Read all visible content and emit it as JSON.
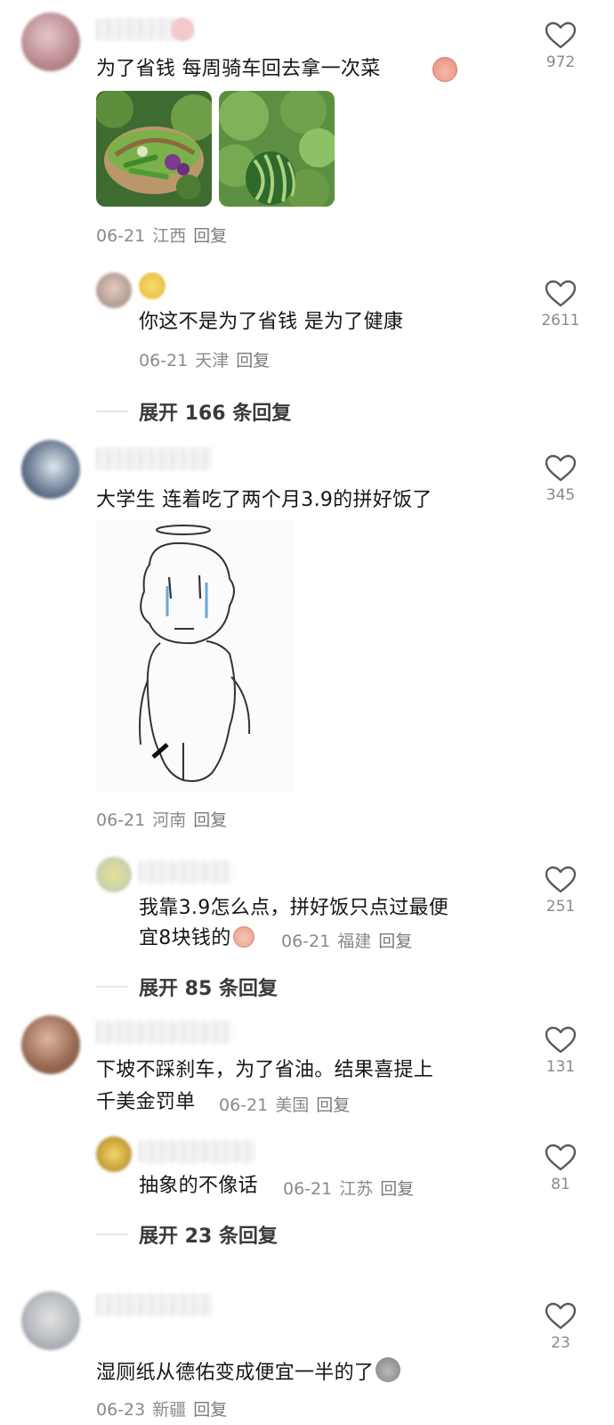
{
  "comments": [
    {
      "text": "为了省钱 每周骑车回去拿一次菜",
      "date": "06-21",
      "location": "江西",
      "reply_label": "回复",
      "likes": "972"
    },
    {
      "text": "你这不是为了省钱 是为了健康",
      "date": "06-21",
      "location": "天津",
      "reply_label": "回复",
      "likes": "2611"
    },
    {
      "text": "大学生 连着吃了两个月3.9的拼好饭了",
      "date": "06-21",
      "location": "河南",
      "reply_label": "回复",
      "likes": "345"
    },
    {
      "text_line1": "我靠3.9怎么点，拼好饭只点过最便",
      "text_line2": "宜8块钱的",
      "date": "06-21",
      "location": "福建",
      "reply_label": "回复",
      "likes": "251"
    },
    {
      "text_line1": "下坡不踩刹车，为了省油。结果喜提上",
      "text_line2": "千美金罚单",
      "date": "06-21",
      "location": "美国",
      "reply_label": "回复",
      "likes": "131"
    },
    {
      "text": "抽象的不像话",
      "date": "06-21",
      "location": "江苏",
      "reply_label": "回复",
      "likes": "81"
    },
    {
      "text": "湿厕纸从德佑变成便宜一半的了",
      "date": "06-23",
      "location": "新疆",
      "reply_label": "回复",
      "likes": "23"
    }
  ],
  "expand_replies": [
    "展开 166 条回复",
    "展开 85 条回复",
    "展开 23 条回复"
  ],
  "icons": {
    "like": "heart-outline-icon",
    "emoji_face": "sweating-face-emoji",
    "emoji_cry": "crying-face-emoji",
    "emoji_blob": "gray-blob-emoji"
  },
  "colors": {
    "text": "#161616",
    "meta": "#8a8a8a",
    "background": "#ffffff"
  }
}
